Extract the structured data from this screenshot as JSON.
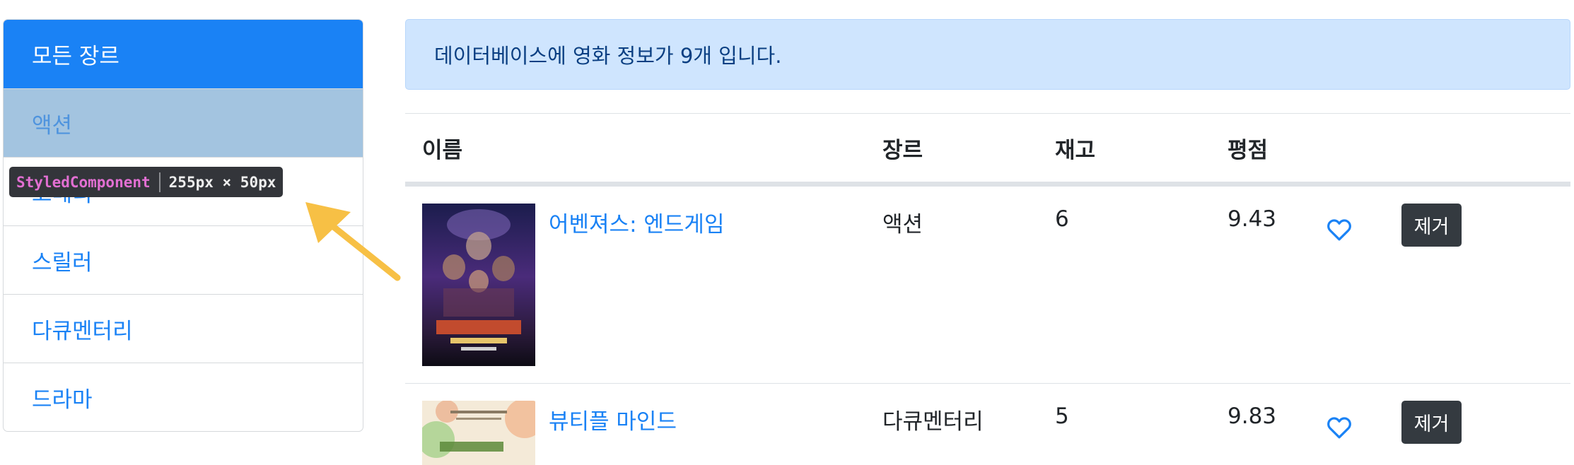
{
  "sidebar": {
    "items": [
      {
        "label": "모든 장르"
      },
      {
        "label": "액션"
      },
      {
        "label": "코메디"
      },
      {
        "label": "스릴러"
      },
      {
        "label": "다큐멘터리"
      },
      {
        "label": "드라마"
      }
    ]
  },
  "devtools_tooltip": {
    "component": "StyledComponent",
    "size": "255px × 50px"
  },
  "alert": {
    "message": "데이터베이스에 영화 정보가 9개 입니다."
  },
  "table": {
    "headers": [
      "이름",
      "장르",
      "재고",
      "평점"
    ],
    "rows": [
      {
        "poster_alt": "어벤져스: 엔드게임 포스터",
        "title": "어벤져스: 엔드게임",
        "genre": "액션",
        "stock": "6",
        "rating": "9.43",
        "remove_label": "제거"
      },
      {
        "poster_alt": "뷰티플 마인드 포스터",
        "title": "뷰티플 마인드",
        "genre": "다큐멘터리",
        "stock": "5",
        "rating": "9.83",
        "remove_label": "제거"
      }
    ]
  },
  "colors": {
    "primary": "#1a82f5",
    "alert_bg": "#cfe5fe",
    "alert_text": "#0b3f82",
    "dark_button": "#343a40",
    "annotation_arrow": "#f7c045"
  },
  "icons": {
    "like": "heart-outline-icon"
  }
}
